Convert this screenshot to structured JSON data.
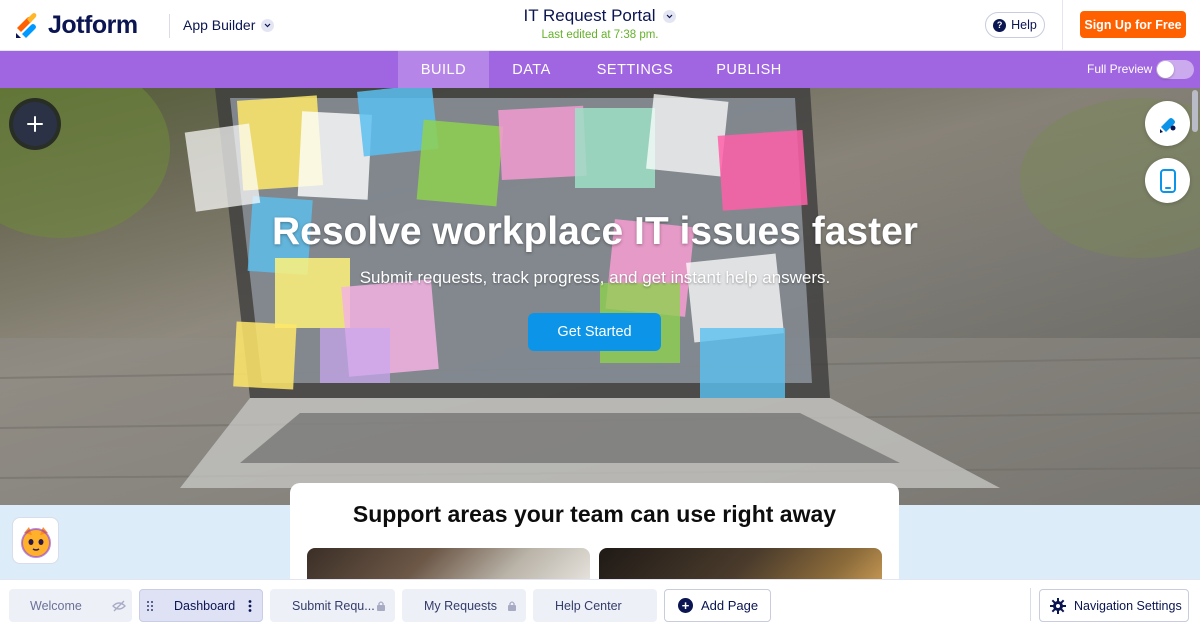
{
  "header": {
    "brand": "Jotform",
    "app_builder_label": "App Builder",
    "app_title": "IT Request Portal",
    "last_edited": "Last edited at 7:38 pm.",
    "help_label": "Help",
    "signup_label": "Sign Up for Free"
  },
  "nav": {
    "tabs": [
      {
        "label": "BUILD",
        "active": true
      },
      {
        "label": "DATA",
        "active": false
      },
      {
        "label": "SETTINGS",
        "active": false
      },
      {
        "label": "PUBLISH",
        "active": false
      }
    ],
    "full_preview_label": "Full Preview",
    "full_preview_on": false
  },
  "hero": {
    "title": "Resolve workplace IT issues faster",
    "subtitle": "Submit requests, track progress, and get instant help answers.",
    "cta_label": "Get Started"
  },
  "section": {
    "title": "Support areas your team can use right away"
  },
  "pages": [
    {
      "label": "Welcome",
      "icon": "eye-off-icon",
      "active": false
    },
    {
      "label": "Dashboard",
      "icon": "more-vertical-icon",
      "active": true
    },
    {
      "label": "Submit Requ...",
      "icon": "lock-icon",
      "active": false
    },
    {
      "label": "My Requests",
      "icon": "lock-icon",
      "active": false
    },
    {
      "label": "Help Center",
      "icon": "",
      "active": false
    }
  ],
  "footer": {
    "add_page_label": "Add Page",
    "navigation_settings_label": "Navigation Settings"
  },
  "colors": {
    "brand_navy": "#0a1551",
    "nav_purple": "#a065e0",
    "signup_orange": "#ff6100",
    "cta_blue": "#0c95e8",
    "edited_green": "#64b22b"
  }
}
